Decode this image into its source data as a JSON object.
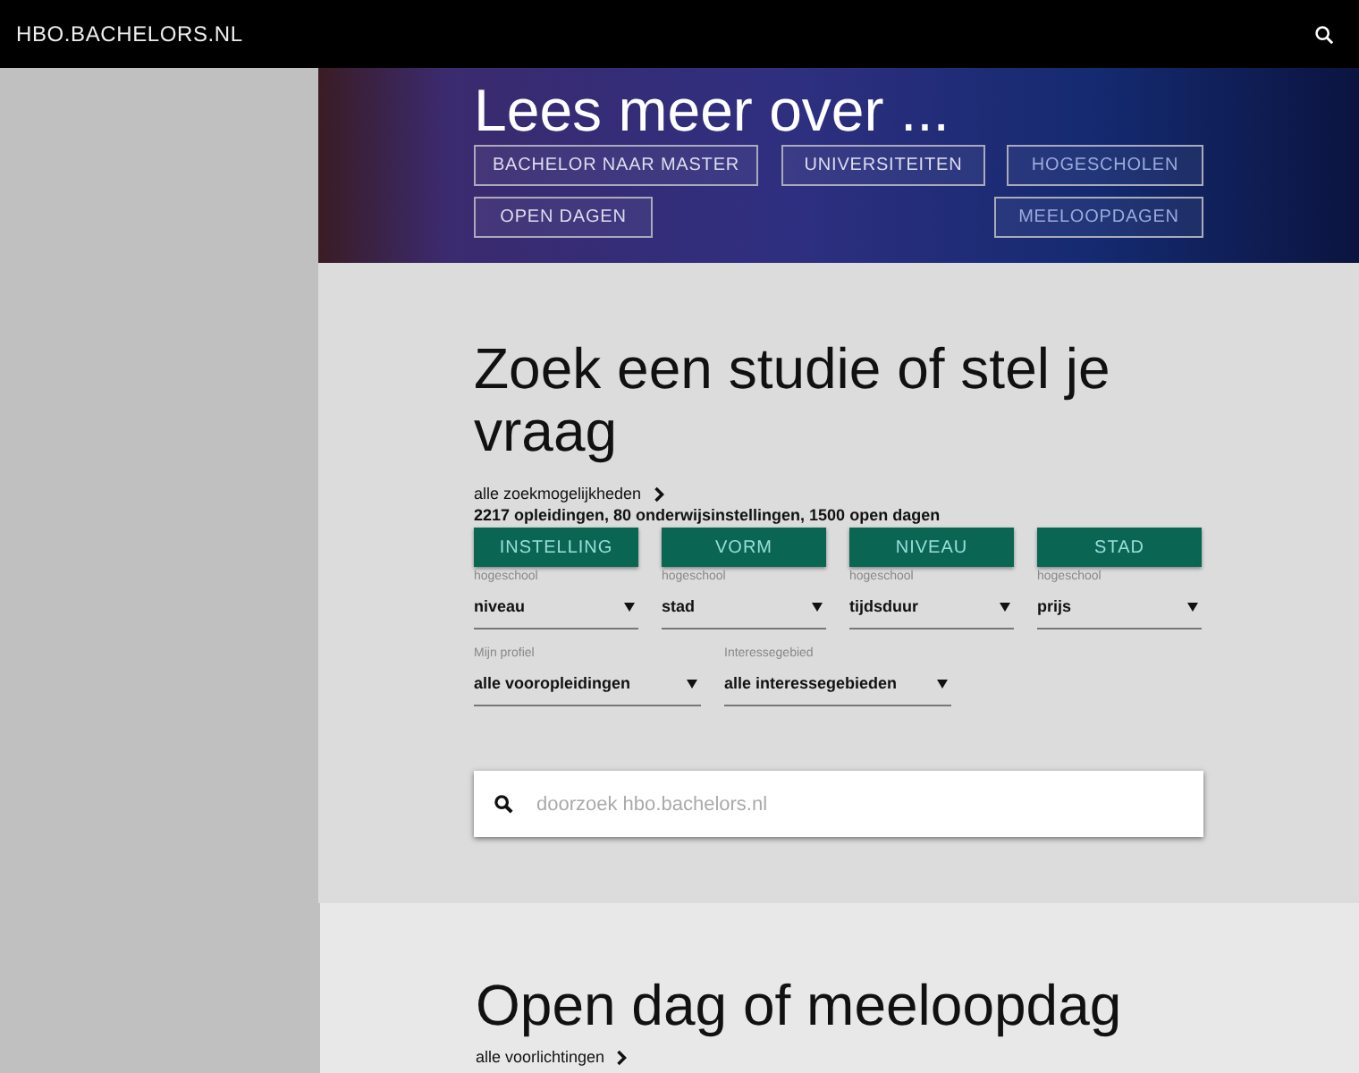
{
  "header": {
    "logo": "HBO.BACHELORS.NL"
  },
  "hero": {
    "title": "Lees meer over ...",
    "links": [
      {
        "label": "BACHELOR NAAR MASTER"
      },
      {
        "label": "UNIVERSITEITEN"
      },
      {
        "label": "HOGESCHOLEN"
      },
      {
        "label": "OPEN DAGEN"
      },
      {
        "label": "MEELOOPDAGEN"
      }
    ]
  },
  "search_section": {
    "title": "Zoek een studie of stel je vraag",
    "more_link": "alle zoekmogelijkheden",
    "stats": "2217 opleidingen, 80 onderwijsinstellingen, 1500 open dagen",
    "filter_buttons": [
      {
        "label": "INSTELLING"
      },
      {
        "label": "VORM"
      },
      {
        "label": "NIVEAU"
      },
      {
        "label": "STAD"
      }
    ],
    "selects": [
      {
        "label": "hogeschool",
        "value": "niveau"
      },
      {
        "label": "hogeschool",
        "value": "stad"
      },
      {
        "label": "hogeschool",
        "value": "tijdsduur"
      },
      {
        "label": "hogeschool",
        "value": "prijs"
      }
    ],
    "profile_selects": [
      {
        "label": "Mijn profiel",
        "value": "alle vooropleidingen"
      },
      {
        "label": "Interessegebied",
        "value": "alle interessegebieden"
      }
    ],
    "search": {
      "placeholder": "doorzoek hbo.bachelors.nl"
    }
  },
  "open_days_section": {
    "title": "Open dag of meeloopdag",
    "more_link": "alle voorlichtingen"
  }
}
